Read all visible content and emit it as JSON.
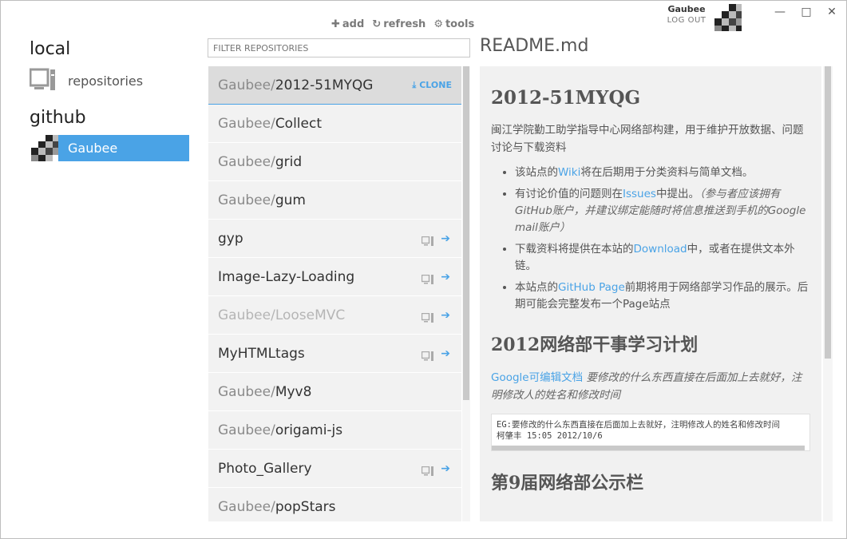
{
  "toolbar": {
    "add": "add",
    "refresh": "refresh",
    "tools": "tools"
  },
  "user": {
    "name": "Gaubee",
    "logout": "LOG OUT"
  },
  "window_controls": {
    "minimize": "✕",
    "maximize": "—",
    "close": "✕"
  },
  "nav": {
    "local_heading": "local",
    "repositories_label": "repositories",
    "github_heading": "github",
    "github_user": "Gaubee"
  },
  "filter": {
    "placeholder": "FILTER REPOSITORIES"
  },
  "repos": [
    {
      "owner": "Gaubee/",
      "name": "2012-51MYQG",
      "selected": true,
      "dim": false,
      "action": "CLONE"
    },
    {
      "owner": "Gaubee/",
      "name": "Collect",
      "selected": false,
      "dim": false,
      "action": ""
    },
    {
      "owner": "Gaubee/",
      "name": "grid",
      "selected": false,
      "dim": false,
      "action": ""
    },
    {
      "owner": "Gaubee/",
      "name": "gum",
      "selected": false,
      "dim": false,
      "action": ""
    },
    {
      "owner": "",
      "name": "gyp",
      "selected": false,
      "dim": false,
      "action": "open"
    },
    {
      "owner": "",
      "name": "Image-Lazy-Loading",
      "selected": false,
      "dim": false,
      "action": "open"
    },
    {
      "owner": "Gaubee/",
      "name": "LooseMVC",
      "selected": false,
      "dim": true,
      "action": "open"
    },
    {
      "owner": "",
      "name": "MyHTMLtags",
      "selected": false,
      "dim": false,
      "action": "open"
    },
    {
      "owner": "Gaubee/",
      "name": "Myv8",
      "selected": false,
      "dim": false,
      "action": ""
    },
    {
      "owner": "Gaubee/",
      "name": "origami-js",
      "selected": false,
      "dim": false,
      "action": ""
    },
    {
      "owner": "",
      "name": "Photo_Gallery",
      "selected": false,
      "dim": false,
      "action": "open"
    },
    {
      "owner": "Gaubee/",
      "name": "popStars",
      "selected": false,
      "dim": false,
      "action": ""
    }
  ],
  "readme": {
    "file": "README.md",
    "h1": "2012-51MYQG",
    "intro": "闽江学院勤工助学指导中心网络部构建，用于维护开放数据、问题讨论与下载资料",
    "bullets": [
      {
        "pre": "该站点的",
        "link": "Wiki",
        "post": "将在后期用于分类资料与简单文档。",
        "note": ""
      },
      {
        "pre": "有讨论价值的问题则在",
        "link": "Issues",
        "post": "中提出。",
        "note": "（参与者应该拥有GitHub账户，并建议绑定能随时将信息推送到手机的Google mail账户）"
      },
      {
        "pre": "下载资料将提供在本站的",
        "link": "Download",
        "post": "中，或者在提供文本外链。",
        "note": ""
      },
      {
        "pre": "本站点的",
        "link": "GitHub Page",
        "post": "前期将用于网络部学习作品的展示。后期可能会完整发布一个Page站点",
        "note": ""
      }
    ],
    "h2a": "2012网络部干事学习计划",
    "plan_link": "Google可编辑文档",
    "plan_note": "要修改的什么东西直接在后面加上去就好，注明修改人的姓名和修改时间",
    "code_line1": "EG:要修改的什么东西直接在后面加上去就好，注明修改人的姓名和修改时间",
    "code_line2": "柯肇丰 15:05 2012/10/6",
    "h2b": "第9届网络部公示栏"
  },
  "colors": {
    "accent": "#4aa3e6",
    "list_bg": "#f2f2f2",
    "selected_bg": "#dcdcdc"
  }
}
